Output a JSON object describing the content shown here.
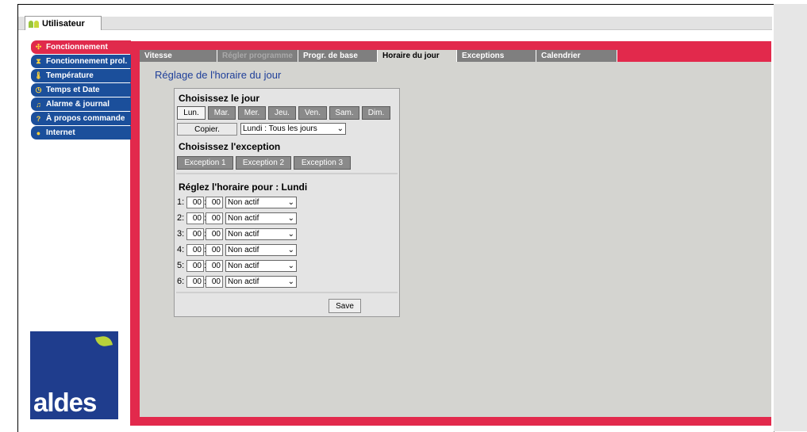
{
  "app": {
    "user_tab": "Utilisateur"
  },
  "sidebar": {
    "items": [
      {
        "label": "Fonctionnement",
        "icon": "fan-icon"
      },
      {
        "label": "Fonctionnement prol.",
        "icon": "hourglass-icon"
      },
      {
        "label": "Température",
        "icon": "thermometer-icon"
      },
      {
        "label": "Temps et Date",
        "icon": "clock-icon"
      },
      {
        "label": "Alarme & journal",
        "icon": "bell-icon"
      },
      {
        "label": "À propos commande",
        "icon": "question-icon"
      },
      {
        "label": "Internet",
        "icon": "globe-icon"
      }
    ]
  },
  "logo": {
    "text": "aldes"
  },
  "tabs": [
    {
      "label": "Vitesse"
    },
    {
      "label": "Régler programme"
    },
    {
      "label": "Progr. de base"
    },
    {
      "label": "Horaire du jour"
    },
    {
      "label": "Exceptions"
    },
    {
      "label": "Calendrier"
    }
  ],
  "page": {
    "title": "Réglage de l'horaire du jour"
  },
  "day_section": {
    "title": "Choisissez le jour",
    "days": [
      "Lun.",
      "Mar.",
      "Mer.",
      "Jeu.",
      "Ven.",
      "Sam.",
      "Dim."
    ],
    "selected": "Lun.",
    "copy_label": "Copier.",
    "copy_select": "Lundi : Tous les jours"
  },
  "exception_section": {
    "title": "Choisissez l'exception",
    "buttons": [
      "Exception 1",
      "Exception 2",
      "Exception 3"
    ]
  },
  "schedule": {
    "title": "Réglez l'horaire pour : Lundi",
    "rows": [
      {
        "label": "1:",
        "hour": "00",
        "minute": "00",
        "mode": "Non actif"
      },
      {
        "label": "2:",
        "hour": "00",
        "minute": "00",
        "mode": "Non actif"
      },
      {
        "label": "3:",
        "hour": "00",
        "minute": "00",
        "mode": "Non actif"
      },
      {
        "label": "4:",
        "hour": "00",
        "minute": "00",
        "mode": "Non actif"
      },
      {
        "label": "5:",
        "hour": "00",
        "minute": "00",
        "mode": "Non actif"
      },
      {
        "label": "6:",
        "hour": "00",
        "minute": "00",
        "mode": "Non actif"
      }
    ],
    "save_label": "Save"
  },
  "colors": {
    "brand_red": "#e2294c",
    "brand_blue": "#1b4f9b",
    "title_blue": "#20409a",
    "panel_gray": "#d4d4d0"
  }
}
